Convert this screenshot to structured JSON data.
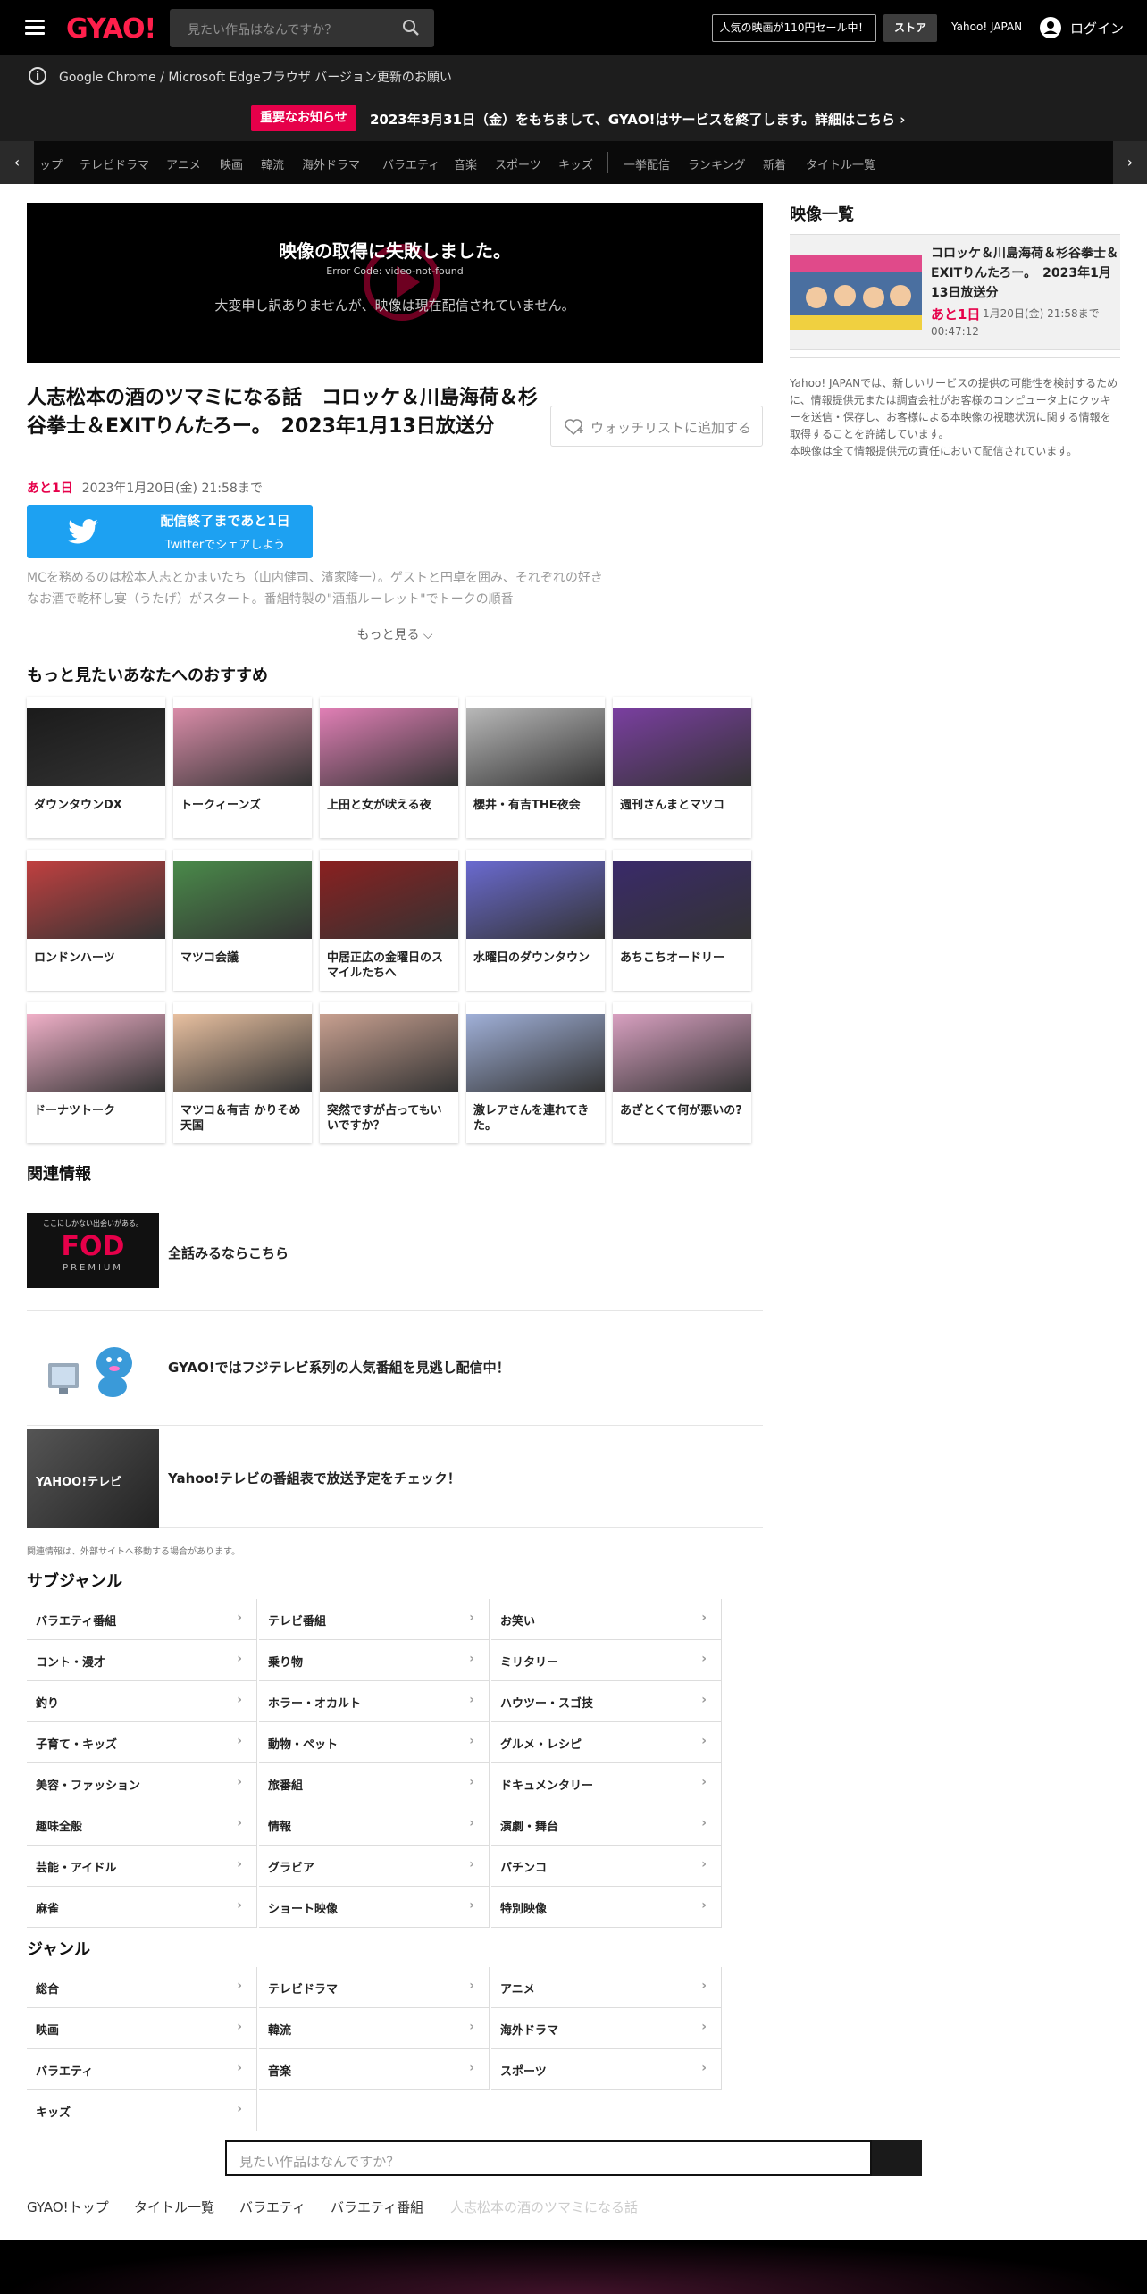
{
  "header": {
    "logo": "GYAO!",
    "search_placeholder": "見たい作品はなんですか？",
    "sale": "人気の映画が110円セール中！",
    "store": "ストア",
    "yahoo": "Yahoo! JAPAN",
    "login": "ログイン"
  },
  "notices": {
    "browser": "Google Chrome / Microsoft Edgeブラウザ バージョン更新のお願い",
    "important_badge": "重要なお知らせ",
    "important_text": "2023年3月31日（金）をもちまして、GYAO!はサービスを終了します。詳細はこちら ›"
  },
  "catnav": {
    "items": [
      "ップ",
      "テレビドラマ",
      "アニメ",
      "映画",
      "韓流",
      "海外ドラマ",
      "バラエティ",
      "音楽",
      "スポーツ",
      "キッズ",
      "一挙配信",
      "ランキング",
      "新着",
      "タイトル一覧"
    ]
  },
  "video": {
    "error": "映像の取得に失敗しました。",
    "code": "Error Code: video-not-found",
    "message": "大変申し訳ありませんが、映像は現在配信されていません。"
  },
  "program": {
    "title": "人志松本の酒のツマミになる話　コロッケ＆川島海荷＆杉谷拳士＆EXITりんたろー。　2023年1月13日放送分",
    "watchlist": "ウォッチリストに追加する",
    "remain": "あと1日",
    "until": "2023年1月20日(金) 21:58まで",
    "twitter_main": "配信終了まであと1日",
    "twitter_sub": "Twitterでシェアしよう",
    "description": "MCを務めるのは松本人志とかまいたち（山内健司、濱家隆一）。ゲストと円卓を囲み、それぞれの好きなお酒で乾杯し宴（うたげ）がスタート。番組特製の\"酒瓶ルーレット\"でトークの順番",
    "more": "もっと見る ⌵"
  },
  "recommend": {
    "title": "もっと見たいあなたへのおすすめ",
    "items": [
      {
        "title": "ダウンタウンDX",
        "color": "#1b1b1b"
      },
      {
        "title": "トークィーンズ",
        "color": "#d98ca8"
      },
      {
        "title": "上田と女が吠える夜",
        "color": "#e07fb5"
      },
      {
        "title": "櫻井・有吉THE夜会",
        "color": "#b8b8b8"
      },
      {
        "title": "週刊さんまとマツコ",
        "color": "#7a3fa0"
      },
      {
        "title": "ロンドンハーツ",
        "color": "#c04040"
      },
      {
        "title": "マツコ会議",
        "color": "#4a8a4a"
      },
      {
        "title": "中居正広の金曜日のスマイルたちへ",
        "color": "#8a2020"
      },
      {
        "title": "水曜日のダウンタウン",
        "color": "#6a6ad0"
      },
      {
        "title": "あちこちオードリー",
        "color": "#3a2a6a"
      },
      {
        "title": "ドーナツトーク",
        "color": "#f0b0c8"
      },
      {
        "title": "マツコ＆有吉 かりそめ天国",
        "color": "#e8c0a0"
      },
      {
        "title": "突然ですが占ってもいいですか？",
        "color": "#c8a090"
      },
      {
        "title": "激レアさんを連れてきた。",
        "color": "#a0b0d8"
      },
      {
        "title": "あざとくて何が悪いの?",
        "color": "#d8a0c0"
      }
    ]
  },
  "related": {
    "title": "関連情報",
    "items": [
      {
        "text": "全話みるならこちら"
      },
      {
        "text": "GYAO!ではフジテレビ系列の人気番組を見逃し配信中！"
      },
      {
        "text": "Yahoo!テレビの番組表で放送予定をチェック！"
      }
    ],
    "fod": "FOD",
    "fod_sub": "PREMIUM",
    "fod_tag": "ここにしかない出会いがある。",
    "yahoo_tv": "YAHOO!テレビ",
    "note": "関連情報は、外部サイトへ移動する場合があります。"
  },
  "subgenre": {
    "title": "サブジャンル",
    "items": [
      "バラエティ番組",
      "テレビ番組",
      "お笑い",
      "コント・漫才",
      "乗り物",
      "ミリタリー",
      "釣り",
      "ホラー・オカルト",
      "ハウツー・スゴ技",
      "子育て・キッズ",
      "動物・ペット",
      "グルメ・レシピ",
      "美容・ファッション",
      "旅番組",
      "ドキュメンタリー",
      "趣味全般",
      "情報",
      "演劇・舞台",
      "芸能・アイドル",
      "グラビア",
      "パチンコ",
      "麻雀",
      "ショート映像",
      "特別映像"
    ]
  },
  "genre": {
    "title": "ジャンル",
    "items": [
      "総合",
      "テレビドラマ",
      "アニメ",
      "映画",
      "韓流",
      "海外ドラマ",
      "バラエティ",
      "音楽",
      "スポーツ",
      "キッズ"
    ]
  },
  "footer": {
    "search_placeholder": "見たい作品はなんですか？",
    "breadcrumb": [
      "GYAO!トップ",
      "タイトル一覧",
      "バラエティ",
      "バラエティ番組",
      "人志松本の酒のツマミになる話"
    ]
  },
  "sidebar": {
    "title": "映像一覧",
    "item_title": "コロッケ＆川島海荷＆杉谷拳士＆EXITりんたろー。　2023年1月13日放送分",
    "item_left": "あと1日",
    "item_until": "1月20日(金) 21:58まで 00:47:12",
    "note": "Yahoo! JAPANでは、新しいサービスの提供の可能性を検討するために、情報提供元または調査会社がお客様のコンピュータ上にクッキーを送信・保存し、お客様による本映像の視聴状況に関する情報を取得することを許諾しています。\n本映像は全て情報提供元の責任において配信されています。"
  },
  "colors": {
    "accent": "#e6004a",
    "logo": "#ff1f4b",
    "twitter": "#1da1f2"
  }
}
